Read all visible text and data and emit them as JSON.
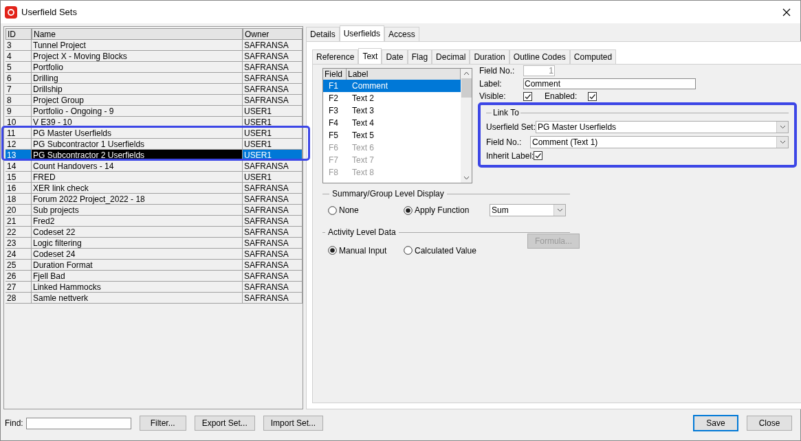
{
  "window": {
    "title": "Userfield Sets"
  },
  "sets": {
    "columns": [
      "ID",
      "Name",
      "Owner"
    ],
    "rows": [
      {
        "id": "3",
        "name": "Tunnel Project",
        "owner": "SAFRANSA",
        "selected": false
      },
      {
        "id": "4",
        "name": "Project X - Moving Blocks",
        "owner": "SAFRANSA",
        "selected": false
      },
      {
        "id": "5",
        "name": "Portfolio",
        "owner": "SAFRANSA",
        "selected": false
      },
      {
        "id": "6",
        "name": "Drilling",
        "owner": "SAFRANSA",
        "selected": false
      },
      {
        "id": "7",
        "name": "Drillship",
        "owner": "SAFRANSA",
        "selected": false
      },
      {
        "id": "8",
        "name": "Project Group",
        "owner": "SAFRANSA",
        "selected": false
      },
      {
        "id": "9",
        "name": "Portfolio - Ongoing - 9",
        "owner": "USER1",
        "selected": false
      },
      {
        "id": "10",
        "name": "V E39 - 10",
        "owner": "USER1",
        "selected": false
      },
      {
        "id": "11",
        "name": "PG Master Userfields",
        "owner": "USER1",
        "selected": false
      },
      {
        "id": "12",
        "name": "PG Subcontractor 1 Userfields",
        "owner": "USER1",
        "selected": false
      },
      {
        "id": "13",
        "name": "PG Subcontractor 2 Userfields",
        "owner": "USER1",
        "selected": true
      },
      {
        "id": "14",
        "name": "Count Handovers - 14",
        "owner": "SAFRANSA",
        "selected": false
      },
      {
        "id": "15",
        "name": "FRED",
        "owner": "USER1",
        "selected": false
      },
      {
        "id": "16",
        "name": "XER link check",
        "owner": "SAFRANSA",
        "selected": false
      },
      {
        "id": "18",
        "name": "Forum 2022 Project_2022 - 18",
        "owner": "SAFRANSA",
        "selected": false
      },
      {
        "id": "20",
        "name": "Sub projects",
        "owner": "SAFRANSA",
        "selected": false
      },
      {
        "id": "21",
        "name": "Fred2",
        "owner": "SAFRANSA",
        "selected": false
      },
      {
        "id": "22",
        "name": "Codeset 22",
        "owner": "SAFRANSA",
        "selected": false
      },
      {
        "id": "23",
        "name": "Logic filtering",
        "owner": "SAFRANSA",
        "selected": false
      },
      {
        "id": "24",
        "name": "Codeset 24",
        "owner": "SAFRANSA",
        "selected": false
      },
      {
        "id": "25",
        "name": "Duration Format",
        "owner": "SAFRANSA",
        "selected": false
      },
      {
        "id": "26",
        "name": "Fjell Bad",
        "owner": "SAFRANSA",
        "selected": false
      },
      {
        "id": "27",
        "name": "Linked Hammocks",
        "owner": "SAFRANSA",
        "selected": false
      },
      {
        "id": "28",
        "name": "Samle nettverk",
        "owner": "SAFRANSA",
        "selected": false
      }
    ]
  },
  "tabs": [
    {
      "label": "Details",
      "selected": false
    },
    {
      "label": "Userfields",
      "selected": true
    },
    {
      "label": "Access",
      "selected": false
    }
  ],
  "subtabs": [
    {
      "label": "Reference",
      "selected": false
    },
    {
      "label": "Text",
      "selected": true
    },
    {
      "label": "Date",
      "selected": false
    },
    {
      "label": "Flag",
      "selected": false
    },
    {
      "label": "Decimal",
      "selected": false
    },
    {
      "label": "Duration",
      "selected": false
    },
    {
      "label": "Outline Codes",
      "selected": false
    },
    {
      "label": "Computed",
      "selected": false
    }
  ],
  "fields": {
    "columns": [
      "Field",
      "Label"
    ],
    "rows": [
      {
        "field": "F1",
        "label": "Comment",
        "selected": true,
        "disabled": false
      },
      {
        "field": "F2",
        "label": "Text 2",
        "selected": false,
        "disabled": false
      },
      {
        "field": "F3",
        "label": "Text 3",
        "selected": false,
        "disabled": false
      },
      {
        "field": "F4",
        "label": "Text 4",
        "selected": false,
        "disabled": false
      },
      {
        "field": "F5",
        "label": "Text 5",
        "selected": false,
        "disabled": false
      },
      {
        "field": "F6",
        "label": "Text 6",
        "selected": false,
        "disabled": true
      },
      {
        "field": "F7",
        "label": "Text 7",
        "selected": false,
        "disabled": true
      },
      {
        "field": "F8",
        "label": "Text 8",
        "selected": false,
        "disabled": true
      }
    ]
  },
  "detail": {
    "field_no": {
      "label": "Field No.:",
      "value": "1",
      "disabled": true
    },
    "label": {
      "label": "Label:",
      "value": "Comment"
    },
    "visible": {
      "label": "Visible:",
      "checked": true
    },
    "enabled": {
      "label": "Enabled:",
      "checked": true
    }
  },
  "link_to": {
    "title": "Link To",
    "userfield_set": {
      "label": "Userfield Set:",
      "value": "PG Master Userfields"
    },
    "field_no": {
      "label": "Field No.:",
      "value": "Comment (Text 1)"
    },
    "inherit_label": {
      "label": "Inherit Label:",
      "checked": true
    }
  },
  "summary": {
    "title": "Summary/Group Level Display",
    "options": [
      {
        "label": "None",
        "selected": false
      },
      {
        "label": "Apply Function",
        "selected": true
      }
    ],
    "function": "Sum"
  },
  "activity": {
    "title": "Activity Level Data",
    "options": [
      {
        "label": "Manual Input",
        "selected": true
      },
      {
        "label": "Calculated Value",
        "selected": false
      }
    ],
    "formula": {
      "label": "Formula...",
      "disabled": true
    }
  },
  "footer": {
    "find_label": "Find:",
    "buttons": [
      "Filter...",
      "Export Set...",
      "Import Set..."
    ],
    "save": "Save",
    "close": "Close"
  }
}
